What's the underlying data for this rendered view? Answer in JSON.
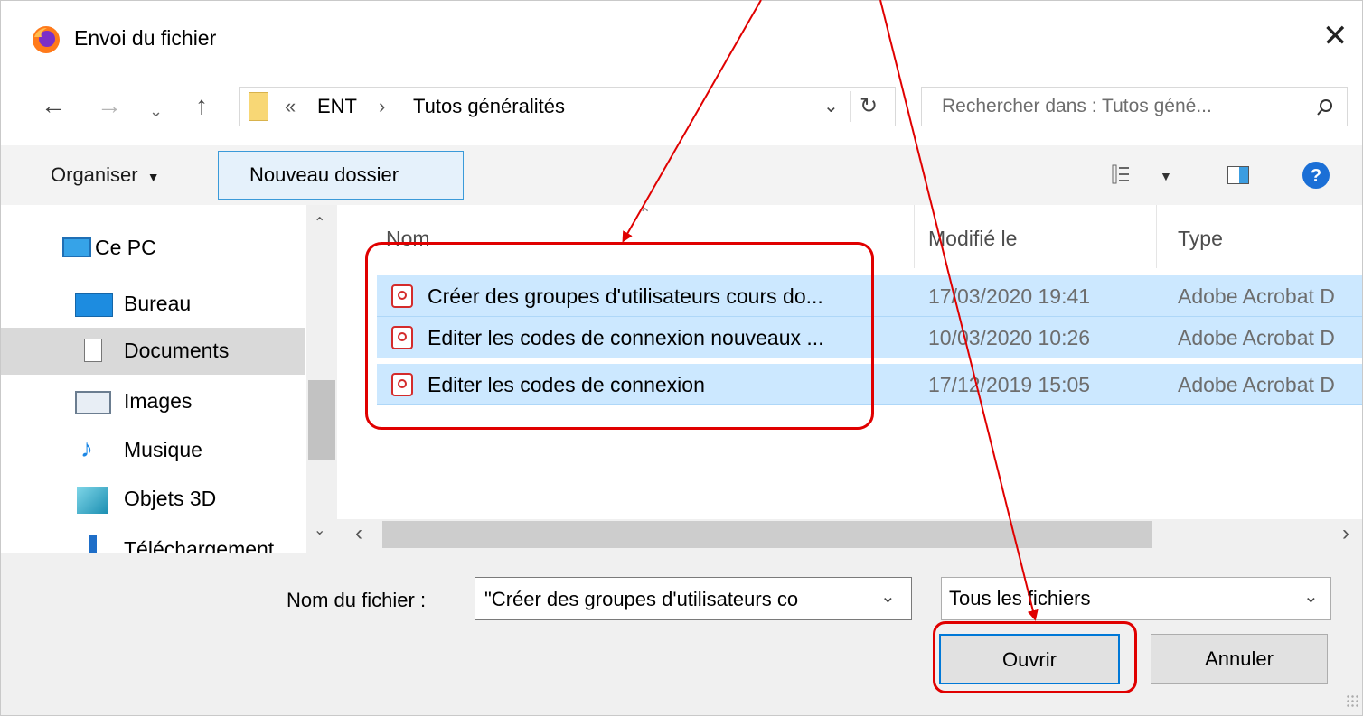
{
  "window": {
    "title": "Envoi du fichier",
    "close_label": "✕"
  },
  "address_bar": {
    "overflow": "«",
    "crumbs": [
      "ENT",
      "Tutos généralités"
    ],
    "separator": "›"
  },
  "search": {
    "placeholder": "Rechercher dans : Tutos géné..."
  },
  "toolbar": {
    "organize_label": "Organiser",
    "new_folder_label": "Nouveau dossier"
  },
  "sidebar": {
    "items": [
      {
        "label": "Ce PC",
        "icon": "monitor-icon"
      },
      {
        "label": "Bureau",
        "icon": "desktop-icon"
      },
      {
        "label": "Documents",
        "icon": "documents-icon"
      },
      {
        "label": "Images",
        "icon": "images-icon"
      },
      {
        "label": "Musique",
        "icon": "music-icon"
      },
      {
        "label": "Objets 3D",
        "icon": "objects-3d-icon"
      },
      {
        "label": "Téléchargement",
        "icon": "downloads-icon"
      }
    ]
  },
  "file_list": {
    "columns": [
      "Nom",
      "Modifié le",
      "Type"
    ],
    "rows": [
      {
        "name": "Créer des groupes d'utilisateurs cours do...",
        "date": "17/03/2020 19:41",
        "type": "Adobe Acrobat D"
      },
      {
        "name": "Editer les codes de connexion nouveaux ...",
        "date": "10/03/2020 10:26",
        "type": "Adobe Acrobat D"
      },
      {
        "name": "Editer les codes de connexion",
        "date": "17/12/2019 15:05",
        "type": "Adobe Acrobat D"
      }
    ]
  },
  "file_name": {
    "label": "Nom du fichier :",
    "value": "\"Créer des groupes d'utilisateurs co"
  },
  "file_type": {
    "value": "Tous les fichiers"
  },
  "buttons": {
    "open": "Ouvrir",
    "cancel": "Annuler"
  },
  "colors": {
    "selection": "#cce8ff",
    "annotation": "#e00000",
    "accent": "#0078d7"
  }
}
